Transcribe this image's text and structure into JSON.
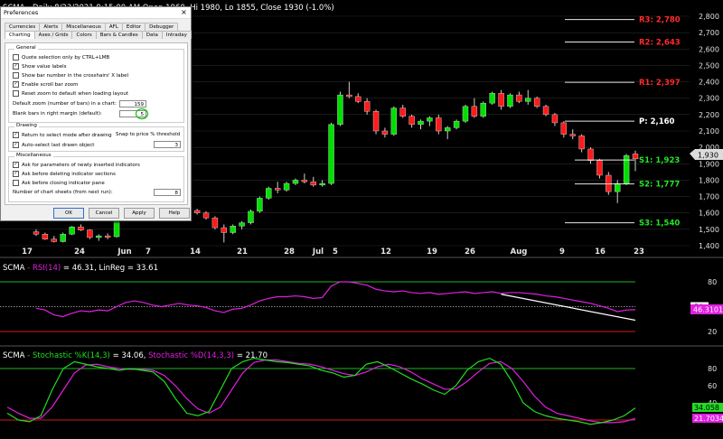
{
  "header": {
    "symbol": "SCMA",
    "info": " - Daily 8/23/2021 9:15:00 AM Open 1960, Hi 1980, Lo 1855, Close 1930 (-1.0%)"
  },
  "price_axis": [
    "2,800",
    "2,700",
    "2,600",
    "2,500",
    "2,400",
    "2,300",
    "2,200",
    "2,100",
    "2,000",
    "1,900",
    "1,800",
    "1,700",
    "1,600",
    "1,500",
    "1,400"
  ],
  "last_price": "1,930",
  "dates": [
    {
      "label": "17",
      "m": false
    },
    {
      "label": "24",
      "m": false
    },
    {
      "label": "Jun",
      "m": true
    },
    {
      "label": "7",
      "m": false
    },
    {
      "label": "14",
      "m": false
    },
    {
      "label": "21",
      "m": false
    },
    {
      "label": "28",
      "m": false
    },
    {
      "label": "Jul",
      "m": true
    },
    {
      "label": "5",
      "m": false
    },
    {
      "label": "12",
      "m": false
    },
    {
      "label": "19",
      "m": false
    },
    {
      "label": "26",
      "m": false
    },
    {
      "label": "Aug",
      "m": true
    },
    {
      "label": "9",
      "m": false
    },
    {
      "label": "16",
      "m": false
    },
    {
      "label": "23",
      "m": false
    }
  ],
  "pivots": [
    {
      "label": "R3: 2,780",
      "color": "#ff2a2a"
    },
    {
      "label": "R2: 2,643",
      "color": "#ff2a2a"
    },
    {
      "label": "R1: 2,397",
      "color": "#ff2a2a"
    },
    {
      "label": "P: 2,160",
      "color": "#ffffff"
    },
    {
      "label": "S1: 1,923",
      "color": "#22e822"
    },
    {
      "label": "S2: 1,777",
      "color": "#22e822"
    },
    {
      "label": "S3: 1,540",
      "color": "#22e822"
    }
  ],
  "rsi": {
    "symbol": "SCMA",
    "name": " - RSI(14)",
    "rest": " = 46.31, LinReg = 33.61",
    "axis": [
      "80",
      "50",
      "20"
    ],
    "value": "46.3101"
  },
  "stoch": {
    "symbol": "SCMA",
    "k_name": " - Stochastic %K(14,3)",
    "k_val": " = 34.06, ",
    "d_name": "Stochastic %D(14,3,3)",
    "d_val": " = 21.70",
    "axis": [
      "80",
      "60",
      "40",
      "20"
    ],
    "k_value": "34.058",
    "d_value": "21.7034"
  },
  "colors": {
    "up": "#00e000",
    "down": "#ff1a1a",
    "rsi": "#e020e0",
    "stoch_k": "#22dd22",
    "stoch_d": "#e020e0"
  },
  "chart_data": {
    "type": "candlestick",
    "price_ylim": [
      1400,
      2800
    ],
    "candles": [
      [
        1485,
        1500,
        1460,
        1470
      ],
      [
        1470,
        1480,
        1435,
        1440
      ],
      [
        1440,
        1460,
        1420,
        1425
      ],
      [
        1425,
        1480,
        1420,
        1470
      ],
      [
        1470,
        1520,
        1465,
        1515
      ],
      [
        1515,
        1530,
        1490,
        1495
      ],
      [
        1495,
        1500,
        1440,
        1450
      ],
      [
        1450,
        1470,
        1430,
        1460
      ],
      [
        1460,
        1475,
        1440,
        1455
      ],
      [
        1455,
        1580,
        1450,
        1570
      ],
      [
        1570,
        1610,
        1560,
        1600
      ],
      [
        1600,
        1640,
        1580,
        1630
      ],
      [
        1630,
        1650,
        1610,
        1620
      ],
      [
        1620,
        1635,
        1580,
        1590
      ],
      [
        1590,
        1600,
        1560,
        1570
      ],
      [
        1570,
        1620,
        1560,
        1610
      ],
      [
        1610,
        1640,
        1600,
        1635
      ],
      [
        1635,
        1640,
        1610,
        1615
      ],
      [
        1615,
        1625,
        1590,
        1600
      ],
      [
        1600,
        1610,
        1560,
        1570
      ],
      [
        1570,
        1580,
        1500,
        1510
      ],
      [
        1510,
        1530,
        1420,
        1480
      ],
      [
        1480,
        1530,
        1470,
        1520
      ],
      [
        1520,
        1550,
        1500,
        1540
      ],
      [
        1540,
        1620,
        1530,
        1610
      ],
      [
        1610,
        1700,
        1600,
        1690
      ],
      [
        1690,
        1760,
        1680,
        1750
      ],
      [
        1750,
        1790,
        1720,
        1740
      ],
      [
        1740,
        1790,
        1730,
        1780
      ],
      [
        1780,
        1810,
        1770,
        1800
      ],
      [
        1800,
        1840,
        1780,
        1790
      ],
      [
        1790,
        1820,
        1760,
        1770
      ],
      [
        1770,
        1800,
        1760,
        1780
      ],
      [
        1780,
        2150,
        1770,
        2140
      ],
      [
        2140,
        2340,
        2130,
        2320
      ],
      [
        2320,
        2400,
        2300,
        2310
      ],
      [
        2310,
        2330,
        2270,
        2280
      ],
      [
        2280,
        2300,
        2200,
        2220
      ],
      [
        2220,
        2230,
        2080,
        2100
      ],
      [
        2100,
        2120,
        2060,
        2080
      ],
      [
        2080,
        2250,
        2070,
        2240
      ],
      [
        2240,
        2260,
        2180,
        2190
      ],
      [
        2190,
        2200,
        2120,
        2140
      ],
      [
        2140,
        2170,
        2110,
        2160
      ],
      [
        2160,
        2190,
        2130,
        2180
      ],
      [
        2180,
        2200,
        2080,
        2100
      ],
      [
        2100,
        2130,
        2050,
        2120
      ],
      [
        2120,
        2170,
        2110,
        2160
      ],
      [
        2160,
        2260,
        2150,
        2250
      ],
      [
        2250,
        2300,
        2180,
        2190
      ],
      [
        2190,
        2280,
        2180,
        2270
      ],
      [
        2270,
        2340,
        2260,
        2330
      ],
      [
        2330,
        2350,
        2230,
        2250
      ],
      [
        2250,
        2330,
        2240,
        2320
      ],
      [
        2320,
        2340,
        2270,
        2280
      ],
      [
        2280,
        2350,
        2260,
        2300
      ],
      [
        2300,
        2310,
        2240,
        2250
      ],
      [
        2250,
        2260,
        2190,
        2200
      ],
      [
        2200,
        2210,
        2130,
        2150
      ],
      [
        2150,
        2160,
        2060,
        2080
      ],
      [
        2080,
        2110,
        2050,
        2070
      ],
      [
        2070,
        2080,
        1970,
        1990
      ],
      [
        1990,
        2000,
        1900,
        1920
      ],
      [
        1920,
        1930,
        1810,
        1830
      ],
      [
        1830,
        1850,
        1710,
        1730
      ],
      [
        1730,
        1800,
        1660,
        1780
      ],
      [
        1780,
        1960,
        1770,
        1950
      ],
      [
        1960,
        1980,
        1855,
        1930
      ]
    ],
    "rsi": [
      48,
      46,
      40,
      38,
      42,
      45,
      44,
      46,
      45,
      50,
      55,
      57,
      55,
      52,
      50,
      52,
      54,
      52,
      51,
      49,
      45,
      43,
      47,
      48,
      52,
      57,
      60,
      62,
      62,
      63,
      62,
      60,
      61,
      75,
      80,
      80,
      78,
      76,
      71,
      69,
      68,
      69,
      67,
      66,
      67,
      65,
      66,
      67,
      68,
      66,
      67,
      68,
      66,
      67,
      67,
      66,
      65,
      63,
      62,
      60,
      58,
      56,
      54,
      51,
      48,
      44,
      46,
      46.31
    ],
    "linreg": [
      [
        52,
        65
      ],
      [
        67,
        33.61
      ]
    ],
    "stoch_k": [
      28,
      20,
      18,
      25,
      55,
      80,
      88,
      85,
      82,
      80,
      78,
      80,
      78,
      76,
      65,
      45,
      28,
      25,
      30,
      55,
      80,
      88,
      92,
      90,
      88,
      87,
      85,
      83,
      78,
      75,
      70,
      72,
      85,
      88,
      82,
      75,
      68,
      62,
      55,
      50,
      60,
      78,
      88,
      92,
      85,
      65,
      40,
      30,
      25,
      22,
      20,
      18,
      15,
      17,
      20,
      25,
      34.06
    ],
    "stoch_d": [
      35,
      28,
      22,
      22,
      35,
      55,
      75,
      84,
      85,
      82,
      80,
      79,
      79,
      78,
      72,
      60,
      45,
      33,
      28,
      35,
      55,
      75,
      87,
      90,
      90,
      88,
      86,
      85,
      82,
      78,
      74,
      72,
      76,
      82,
      85,
      82,
      76,
      68,
      62,
      56,
      56,
      65,
      76,
      86,
      88,
      80,
      65,
      48,
      35,
      28,
      25,
      22,
      19,
      17,
      17,
      18,
      21.7
    ]
  },
  "dialog": {
    "title": "Preferences",
    "tabs_row1": [
      "Currencies",
      "Alerts",
      "Miscellaneous",
      "AFL",
      "Editor",
      "Debugger"
    ],
    "tabs_row2": [
      "Charting",
      "Axes / Grids",
      "Colors",
      "Bars & Candles",
      "Data",
      "Intraday"
    ],
    "general_title": "General",
    "general": [
      {
        "label": "Quote selection only by CTRL+LMB",
        "checked": false
      },
      {
        "label": "Show value labels",
        "checked": true
      },
      {
        "label": "Show bar number in the crosshairs' X label",
        "checked": false
      },
      {
        "label": "Enable scroll bar zoom",
        "checked": true
      },
      {
        "label": "Reset zoom to default when loading layout",
        "checked": false
      }
    ],
    "zoom_label": "Default zoom (number of bars) in a chart:",
    "zoom_value": "159",
    "margin_label": "Blank bars in right margin (default):",
    "margin_value": "5",
    "drawing_title": "Drawing",
    "drawing": [
      {
        "label": "Return to select mode after drawing",
        "checked": true
      },
      {
        "label": "Auto-select last drawn object",
        "checked": true
      }
    ],
    "snap_label": "Snap to price % threshold",
    "snap_value": "3",
    "misc_title": "Miscellaneous",
    "misc": [
      {
        "label": "Ask for parameters of newly inserted indicators",
        "checked": true
      },
      {
        "label": "Ask before deleting indicator sections",
        "checked": true
      },
      {
        "label": "Ask before closing indicator pane",
        "checked": false
      }
    ],
    "sheets_label": "Number of chart sheets (from next run):",
    "sheets_value": "8",
    "buttons": {
      "ok": "OK",
      "cancel": "Cancel",
      "apply": "Apply",
      "help": "Help"
    },
    "check_mark": "✓"
  }
}
